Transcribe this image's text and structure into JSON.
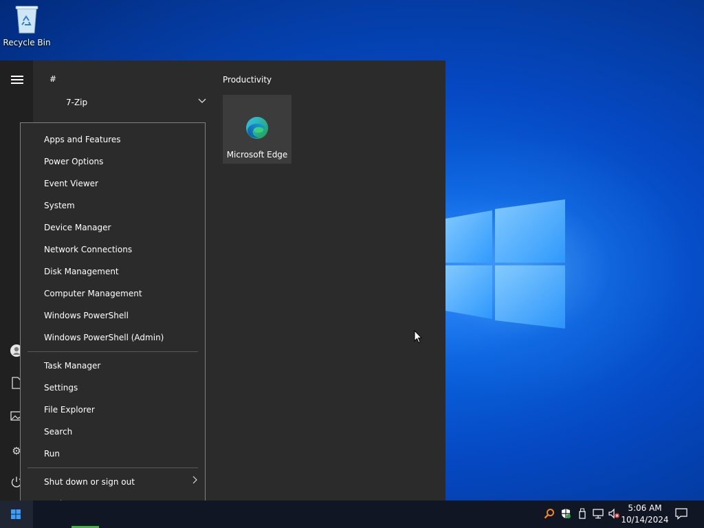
{
  "desktop": {
    "recycle_bin_label": "Recycle Bin"
  },
  "start_menu": {
    "letter_header": "#",
    "app_entry": "7-Zip",
    "group_header": "Productivity",
    "tile_label": "Microsoft Edge",
    "rail_icons": [
      "hamburger-menu-icon",
      "user-icon",
      "document-icon",
      "pictures-icon",
      "settings-icon",
      "power-icon"
    ]
  },
  "context_menu": {
    "group1": [
      "Apps and Features",
      "Power Options",
      "Event Viewer",
      "System",
      "Device Manager",
      "Network Connections",
      "Disk Management",
      "Computer Management",
      "Windows PowerShell",
      "Windows PowerShell (Admin)"
    ],
    "group2": [
      "Task Manager",
      "Settings",
      "File Explorer",
      "Search",
      "Run"
    ],
    "group3": [
      "Shut down or sign out",
      "Desktop"
    ]
  },
  "taskbar": {
    "time": "5:06 AM",
    "date": "10/14/2024",
    "tray_icons": [
      "search-tool-icon",
      "defender-shield-icon",
      "usb-device-icon",
      "network-icon",
      "volume-muted-icon"
    ]
  },
  "colors": {
    "desktop_blue": "#0548c2",
    "menu_background": "#2b2b2b",
    "taskbar_background": "#101623",
    "running_indicator": "#3fb53f"
  }
}
